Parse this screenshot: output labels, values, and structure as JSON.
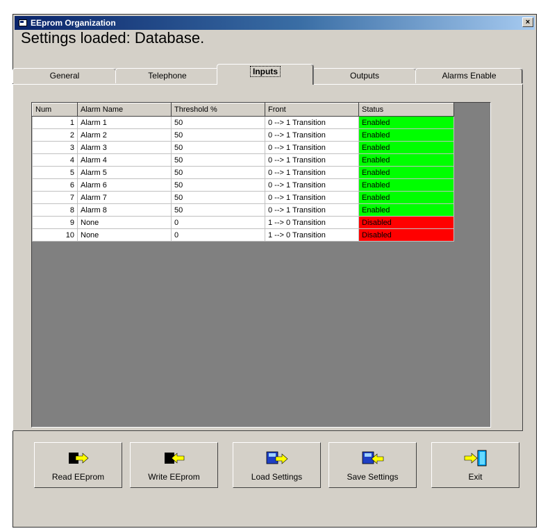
{
  "window": {
    "title": "EEprom Organization",
    "close_label": "×"
  },
  "status_text": "Settings loaded:  Database.",
  "tabs": [
    {
      "label": "General"
    },
    {
      "label": "Telephone"
    },
    {
      "label": "Inputs"
    },
    {
      "label": "Outputs"
    },
    {
      "label": "Alarms Enable"
    }
  ],
  "active_tab": "Inputs",
  "table": {
    "columns": [
      "Num",
      "Alarm Name",
      "Threshold %",
      "Front",
      "Status"
    ],
    "rows": [
      {
        "num": "1",
        "name": "Alarm 1",
        "threshold": "50",
        "front": "0 --> 1 Transition",
        "status": "Enabled"
      },
      {
        "num": "2",
        "name": "Alarm 2",
        "threshold": "50",
        "front": "0 --> 1 Transition",
        "status": "Enabled"
      },
      {
        "num": "3",
        "name": "Alarm 3",
        "threshold": "50",
        "front": "0 --> 1 Transition",
        "status": "Enabled"
      },
      {
        "num": "4",
        "name": "Alarm 4",
        "threshold": "50",
        "front": "0 --> 1 Transition",
        "status": "Enabled"
      },
      {
        "num": "5",
        "name": "Alarm 5",
        "threshold": "50",
        "front": "0 --> 1 Transition",
        "status": "Enabled"
      },
      {
        "num": "6",
        "name": "Alarm 6",
        "threshold": "50",
        "front": "0 --> 1 Transition",
        "status": "Enabled"
      },
      {
        "num": "7",
        "name": "Alarm 7",
        "threshold": "50",
        "front": "0 --> 1 Transition",
        "status": "Enabled"
      },
      {
        "num": "8",
        "name": "Alarm 8",
        "threshold": "50",
        "front": "0 --> 1 Transition",
        "status": "Enabled"
      },
      {
        "num": "9",
        "name": "None",
        "threshold": "0",
        "front": "1 --> 0 Transition",
        "status": "Disabled"
      },
      {
        "num": "10",
        "name": "None",
        "threshold": "0",
        "front": "1 --> 0 Transition",
        "status": "Disabled"
      }
    ]
  },
  "colors": {
    "enabled": "#00ff00",
    "disabled": "#ff0000",
    "title_bar": "#0a246a"
  },
  "buttons": [
    {
      "label": "Read EEprom",
      "icon": "read-eeprom-icon"
    },
    {
      "label": "Write EEprom",
      "icon": "write-eeprom-icon"
    },
    {
      "label": "Load Settings",
      "icon": "load-settings-icon"
    },
    {
      "label": "Save Settings",
      "icon": "save-settings-icon"
    },
    {
      "label": "Exit",
      "icon": "exit-door-icon"
    }
  ]
}
